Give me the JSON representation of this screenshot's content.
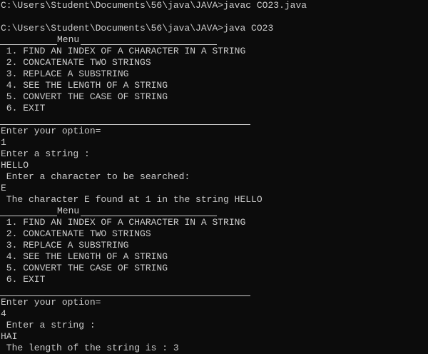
{
  "console": {
    "line1": "C:\\Users\\Student\\Documents\\56\\java\\JAVA>javac CO23.java",
    "line2": "",
    "line3": "C:\\Users\\Student\\Documents\\56\\java\\JAVA>java CO23",
    "menu1_title": "Menu",
    "menu1_items": [
      " 1. FIND AN INDEX OF A CHARACTER IN A STRING",
      " 2. CONCATENATE TWO STRINGS",
      " 3. REPLACE A SUBSTRING",
      " 4. SEE THE LENGTH OF A STRING",
      " 5. CONVERT THE CASE OF STRING",
      " 6. EXIT"
    ],
    "prompt_option_1": "Enter your option=",
    "input_option_1": "1",
    "prompt_string_1": "Enter a string :",
    "input_string_1": "HELLO",
    "prompt_char": " Enter a character to be searched:",
    "input_char": "E",
    "result_1": " The character E found at 1 in the string HELLO",
    "menu2_title": "Menu",
    "menu2_items": [
      " 1. FIND AN INDEX OF A CHARACTER IN A STRING",
      " 2. CONCATENATE TWO STRINGS",
      " 3. REPLACE A SUBSTRING",
      " 4. SEE THE LENGTH OF A STRING",
      " 5. CONVERT THE CASE OF STRING",
      " 6. EXIT"
    ],
    "prompt_option_2": "Enter your option=",
    "input_option_2": "4",
    "prompt_string_2": " Enter a string :",
    "input_string_2": "HAI",
    "result_2": " The length of the string is : 3"
  }
}
